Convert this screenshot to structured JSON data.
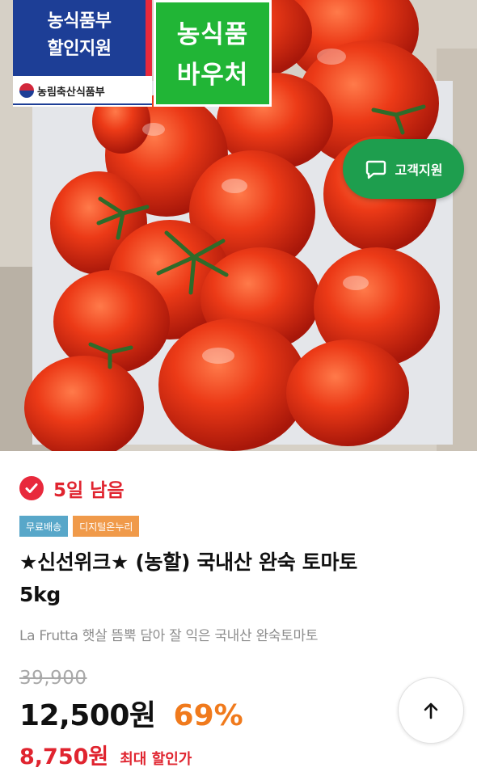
{
  "product_image": {
    "badge_gov": {
      "line1": "농식품부",
      "line2": "할인지원",
      "ministry": "농림축산식품부"
    },
    "badge_voucher": {
      "line1": "농식품",
      "line2": "바우처"
    }
  },
  "support_button": {
    "label": "고객지원",
    "icon": "chat-bubble-icon",
    "color": "#1e9e4e"
  },
  "timer": {
    "icon": "clock-check-icon",
    "text": "5일 남음",
    "color": "#e0242f"
  },
  "tags": [
    {
      "label": "무료배송",
      "color": "#58a7c9"
    },
    {
      "label": "디지털온누리",
      "color": "#f09a4a"
    }
  ],
  "product": {
    "title_line1": "★신선위크★ (농할) 국내산 완숙 토마토",
    "title_line2": "5kg",
    "subtitle": "La Frutta 햇살 뜸뿍 담아 잘 익은 국내산 완숙토마토"
  },
  "pricing": {
    "original": "39,900",
    "price": "12,500원",
    "discount": "69%",
    "max_price": "8,750원",
    "max_label": "최대 할인가"
  },
  "scroll_top_button": {
    "icon": "arrow-up-icon"
  }
}
